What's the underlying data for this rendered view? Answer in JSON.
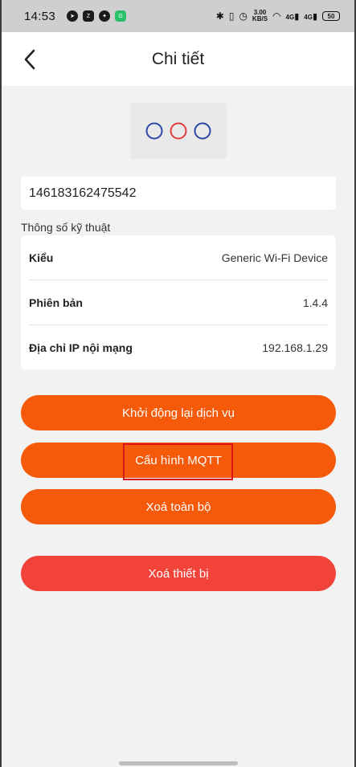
{
  "status_bar": {
    "time": "14:53",
    "net_speed_top": "3.00",
    "net_speed_bottom": "KB/S",
    "signal1": "4G",
    "signal2": "4G",
    "battery": "50"
  },
  "header": {
    "title": "Chi tiết"
  },
  "device_icon": {
    "circles": [
      "#2b48a8",
      "#e33b3b",
      "#2b48a8"
    ]
  },
  "device": {
    "id": "146183162475542"
  },
  "specs": {
    "title": "Thông số kỹ thuật",
    "rows": [
      {
        "label": "Kiểu",
        "value": "Generic Wi-Fi Device"
      },
      {
        "label": "Phiên bản",
        "value": "1.4.4"
      },
      {
        "label": "Địa chỉ IP nội mạng",
        "value": "192.168.1.29"
      }
    ]
  },
  "buttons": {
    "restart": "Khởi động lại dịch vụ",
    "mqtt": "Cấu hình MQTT",
    "clear_all": "Xoá toàn bộ",
    "delete_device": "Xoá thiết bị"
  },
  "colors": {
    "primary_orange": "#f55a0a",
    "danger_red": "#f2433b",
    "highlight": "#d8151b"
  }
}
